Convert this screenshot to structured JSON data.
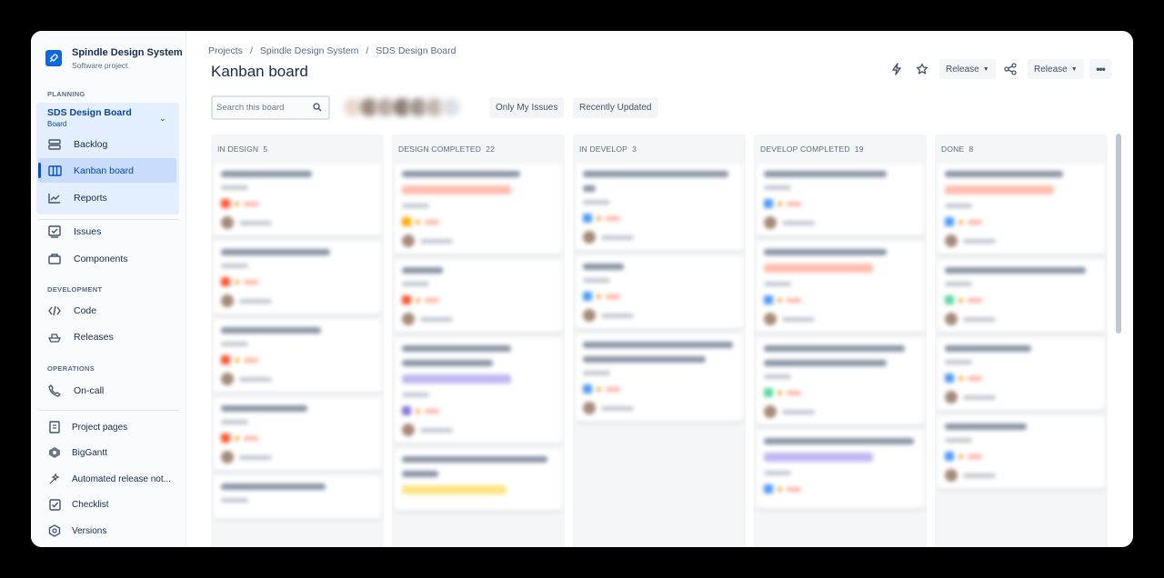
{
  "project": {
    "name": "Spindle Design System",
    "type": "Software project"
  },
  "sidebar": {
    "sections": {
      "planning": "PLANNING",
      "development": "DEVELOPMENT",
      "operations": "OPERATIONS"
    },
    "board": {
      "name": "SDS Design Board",
      "sub": "Board"
    },
    "planning_items": [
      {
        "label": "Backlog",
        "icon": "backlog-icon"
      },
      {
        "label": "Kanban board",
        "icon": "board-icon"
      },
      {
        "label": "Reports",
        "icon": "reports-icon"
      }
    ],
    "items": [
      {
        "label": "Issues",
        "icon": "issues-icon"
      },
      {
        "label": "Components",
        "icon": "components-icon"
      }
    ],
    "development_items": [
      {
        "label": "Code",
        "icon": "code-icon"
      },
      {
        "label": "Releases",
        "icon": "releases-icon"
      }
    ],
    "operations_items": [
      {
        "label": "On-call",
        "icon": "oncall-icon"
      }
    ],
    "apps": [
      {
        "label": "Project pages",
        "icon": "pages-icon"
      },
      {
        "label": "BigGantt",
        "icon": "biggantt-icon"
      },
      {
        "label": "Automated release not...",
        "icon": "automation-icon"
      },
      {
        "label": "Checklist",
        "icon": "checklist-icon"
      },
      {
        "label": "Versions",
        "icon": "versions-icon"
      }
    ]
  },
  "breadcrumbs": [
    "Projects",
    "/",
    "Spindle Design System",
    "/",
    "SDS Design Board"
  ],
  "header": {
    "title": "Kanban board",
    "release1": "Release",
    "release2": "Release"
  },
  "filters": {
    "search_placeholder": "Search this board",
    "only_my": "Only My Issues",
    "recent": "Recently Updated"
  },
  "columns": [
    {
      "title": "IN DESIGN",
      "count": "5"
    },
    {
      "title": "DESIGN COMPLETED",
      "count": "22"
    },
    {
      "title": "IN DEVELOP",
      "count": "3"
    },
    {
      "title": "DEVELOP COMPLETED",
      "count": "19"
    },
    {
      "title": "DONE",
      "count": "8"
    }
  ],
  "colors": {
    "accent": "#0052cc",
    "selected_bg": "#deebff",
    "column_bg": "#f4f5f7"
  }
}
